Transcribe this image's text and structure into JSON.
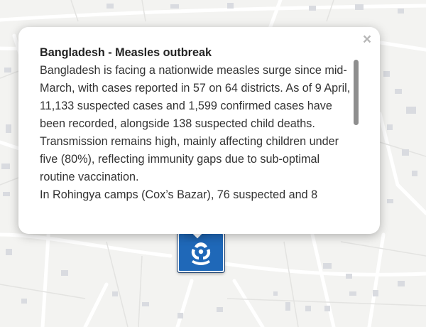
{
  "popup": {
    "title": "Bangladesh - Measles outbreak",
    "paragraphs": [
      "Bangladesh is facing a nationwide measles surge since mid-March, with cases reported in 57 on 64 districts. As of 9 April, 11,133 suspected cases and 1,599 confirmed cases have been recorded, alongside 138 suspected child deaths.",
      "Transmission remains high, mainly affecting children under five (80%), reflecting immunity gaps due to sub-optimal routine vaccination.",
      "In Rohingya camps (Cox’s Bazar), 76 suspected and 8"
    ],
    "close_label": "×"
  },
  "marker": {
    "icon": "biohazard-icon",
    "color": "#1f68b8"
  },
  "map": {
    "background": "#f3f3f1",
    "road_color": "#ffffff",
    "building_color": "#d9dbe0"
  }
}
